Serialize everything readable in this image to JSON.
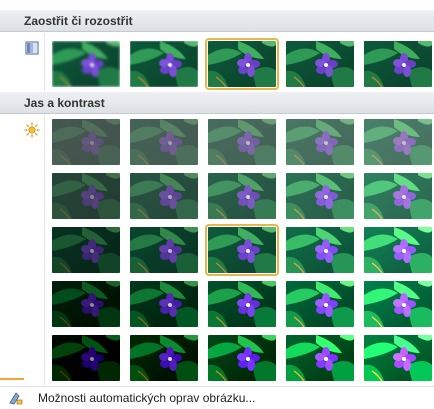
{
  "sections": [
    {
      "title": "Zaostřit či rozostřit",
      "icon": "sharpen-icon",
      "rows": 1,
      "cols": 5,
      "selected": [
        0,
        2
      ]
    },
    {
      "title": "Jas a kontrast",
      "icon": "brightness-icon",
      "rows": 5,
      "cols": 5,
      "selected": [
        2,
        2
      ]
    }
  ],
  "footer": {
    "label": "Možnosti automatických oprav obrázku...",
    "icon": "picture-corrections-icon"
  },
  "colors": {
    "accent_selection": "#e6b84a",
    "header_bg": "#dde1e6"
  }
}
